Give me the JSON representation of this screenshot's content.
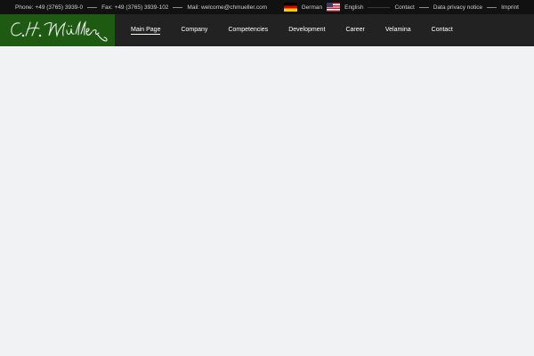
{
  "topbar": {
    "phone": "Phone: +49 (3765) 3939-0",
    "fax": "Fax: +49 (3765) 3939-102",
    "mail": "Mail: welcome@chmueller.com",
    "languages": [
      {
        "label": "German",
        "icon": "german-flag-icon"
      },
      {
        "label": "English",
        "icon": "us-flag-icon"
      }
    ],
    "links": [
      "Contact",
      "Data privacy notice",
      "Imprint"
    ]
  },
  "logo": {
    "brand_color": "#1e5a12"
  },
  "nav": {
    "items": [
      "Main Page",
      "Company",
      "Competencies",
      "Development",
      "Career",
      "Velamina",
      "Contact"
    ],
    "active": "Main Page"
  },
  "colors": {
    "topbar_bg": "#111111",
    "header_bg": "#222222",
    "content_bg": "#f1f2f3"
  }
}
